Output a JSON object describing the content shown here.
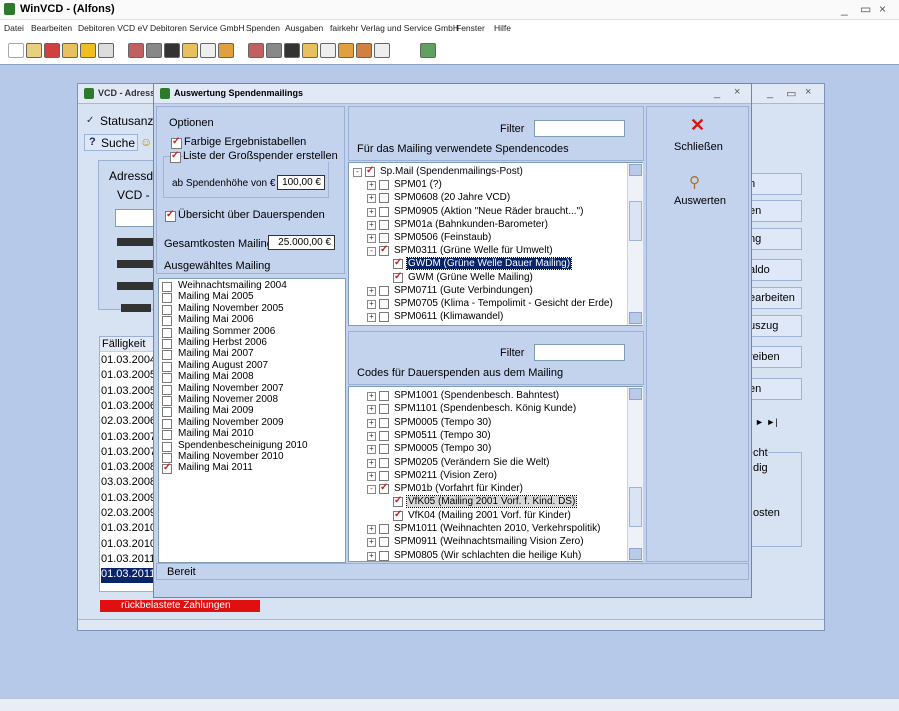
{
  "app": {
    "title": "WinVCD - (Alfons)"
  },
  "menu": [
    "Datei",
    "Bearbeiten",
    "Debitoren VCD eV",
    "Debitoren Service GmbH",
    "Spenden",
    "Ausgaben",
    "fairkehr Verlag und Service GmbH",
    "Fenster",
    "Hilfe"
  ],
  "toolbar": {
    "euro": "€"
  },
  "child": {
    "title": "VCD - Adressen",
    "statusanzeige": "Statusanzeige",
    "suche": "Suche",
    "adressda": "Adressda",
    "vcd_n": "VCD - N",
    "faelligkeit_header": "Fälligkeit",
    "dates": [
      "01.03.2004",
      "01.03.2005",
      "01.03.2005",
      "01.03.2006",
      "02.03.2006",
      "01.03.2007",
      "01.03.2007",
      "01.03.2008",
      "03.03.2008",
      "01.03.2009",
      "02.03.2009",
      "01.03.2010",
      "01.03.2010",
      "01.03.2011",
      "01.03.2011"
    ],
    "rueckbelastete": "rückbelastete Zahlungen",
    "right_buttons": [
      "n",
      "en",
      "ng",
      "aldo",
      "earbeiten",
      "uszug",
      "reiben",
      "en"
    ],
    "nav": "►    ►|",
    "right_texts": [
      "cht",
      "dig",
      "osten"
    ]
  },
  "dialog": {
    "title": "Auswertung Spendenmailings",
    "optionen": "Optionen",
    "farbige": "Farbige Ergebnistabellen",
    "liste": "Liste der Großspender erstellen",
    "ab_label": "ab Spendenhöhe von €",
    "ab_value": "100,00 €",
    "uebersicht": "Übersicht über Dauerspenden",
    "gesamt_label": "Gesamtkosten Mailing",
    "gesamt_value": "25.000,00 €",
    "ausgewaehlt": "Ausgewähltes Mailing",
    "mailings": [
      {
        "label": "Weihnachtsmailing 2004",
        "checked": false
      },
      {
        "label": "Mailing Mai 2005",
        "checked": false
      },
      {
        "label": "Mailing November 2005",
        "checked": false
      },
      {
        "label": "Mailing Mai 2006",
        "checked": false
      },
      {
        "label": "Mailing Sommer 2006",
        "checked": false
      },
      {
        "label": "Mailing Herbst 2006",
        "checked": false
      },
      {
        "label": "Mailing Mai 2007",
        "checked": false
      },
      {
        "label": "Mailing August 2007",
        "checked": false
      },
      {
        "label": "Mailing Mai 2008",
        "checked": false
      },
      {
        "label": "Mailing November 2007",
        "checked": false
      },
      {
        "label": "Mailing Novemer 2008",
        "checked": false
      },
      {
        "label": "Mailing Mai 2009",
        "checked": false
      },
      {
        "label": "Mailing November 2009",
        "checked": false
      },
      {
        "label": "Mailing Mai 2010",
        "checked": false
      },
      {
        "label": "Spendenbescheinigung 2010",
        "checked": false
      },
      {
        "label": "Mailing November 2010",
        "checked": false
      },
      {
        "label": "Mailing Mai 2011",
        "checked": true
      }
    ],
    "filter_label": "Filter",
    "codes_header": "Für das Mailing verwendete Spendencodes",
    "codes_tree": [
      {
        "label": "Sp.Mail (Spendenmailings-Post)",
        "level": 0,
        "exp": "-",
        "checked": true,
        "sel": false
      },
      {
        "label": "SPM01 (?)",
        "level": 1,
        "exp": "+",
        "checked": false,
        "sel": false
      },
      {
        "label": "SPM0608 (20 Jahre VCD)",
        "level": 1,
        "exp": "+",
        "checked": false,
        "sel": false
      },
      {
        "label": "SPM0905 (Aktion \"Neue Räder braucht...\")",
        "level": 1,
        "exp": "+",
        "checked": false,
        "sel": false
      },
      {
        "label": "SPM01a (Bahnkunden-Barometer)",
        "level": 1,
        "exp": "+",
        "checked": false,
        "sel": false
      },
      {
        "label": "SPM0506 (Feinstaub)",
        "level": 1,
        "exp": "+",
        "checked": false,
        "sel": false
      },
      {
        "label": "SPM0311 (Grüne Welle für Umwelt)",
        "level": 1,
        "exp": "-",
        "checked": true,
        "sel": false
      },
      {
        "label": "GWDM (Grüne Welle Dauer Mailing)",
        "level": 2,
        "exp": "",
        "checked": true,
        "sel": true
      },
      {
        "label": "GWM (Grüne Welle Mailing)",
        "level": 2,
        "exp": "",
        "checked": true,
        "sel": false
      },
      {
        "label": "SPM0711 (Gute Verbindungen)",
        "level": 1,
        "exp": "+",
        "checked": false,
        "sel": false
      },
      {
        "label": "SPM0705 (Klima - Tempolimit - Gesicht der Erde)",
        "level": 1,
        "exp": "+",
        "checked": false,
        "sel": false
      },
      {
        "label": "SPM0611 (Klimawandel)",
        "level": 1,
        "exp": "+",
        "checked": false,
        "sel": false
      }
    ],
    "dauer_header": "Codes für Dauerspenden aus dem Mailing",
    "dauer_tree": [
      {
        "label": "SPM1001 (Spendenbesch. Bahntest)",
        "level": 1,
        "exp": "+",
        "checked": false,
        "sel": false
      },
      {
        "label": "SPM1101 (Spendenbesch. König Kunde)",
        "level": 1,
        "exp": "+",
        "checked": false,
        "sel": false
      },
      {
        "label": "SPM0005 (Tempo 30)",
        "level": 1,
        "exp": "+",
        "checked": false,
        "sel": false
      },
      {
        "label": "SPM0511 (Tempo 30)",
        "level": 1,
        "exp": "+",
        "checked": false,
        "sel": false
      },
      {
        "label": "SPM0005 (Tempo 30)",
        "level": 1,
        "exp": "+",
        "checked": false,
        "sel": false
      },
      {
        "label": "SPM0205 (Verändern Sie die Welt)",
        "level": 1,
        "exp": "+",
        "checked": false,
        "sel": false
      },
      {
        "label": "SPM0211 (Vision Zero)",
        "level": 1,
        "exp": "+",
        "checked": false,
        "sel": false
      },
      {
        "label": "SPM01b (Vorfahrt für Kinder)",
        "level": 1,
        "exp": "-",
        "checked": true,
        "sel": false
      },
      {
        "label": "VfK05 (Mailing 2001 Vorf. f. Kind. DS)",
        "level": 2,
        "exp": "",
        "checked": true,
        "sel": true
      },
      {
        "label": "VfK04 (Mailing 2001 Vorf. für Kinder)",
        "level": 2,
        "exp": "",
        "checked": true,
        "sel": false
      },
      {
        "label": "SPM1011 (Weihnachten 2010, Verkehrspolitik)",
        "level": 1,
        "exp": "+",
        "checked": false,
        "sel": false
      },
      {
        "label": "SPM0911 (Weihnachtsmailing Vision Zero)",
        "level": 1,
        "exp": "+",
        "checked": false,
        "sel": false
      },
      {
        "label": "SPM0805 (Wir schlachten die heilige Kuh)",
        "level": 1,
        "exp": "+",
        "checked": false,
        "sel": false
      }
    ],
    "schliessen": "Schließen",
    "auswerten": "Auswerten",
    "status": "Bereit"
  },
  "colors": {
    "mdi": "#b7c9e8",
    "selection": "#0a246a",
    "red": "#e01010"
  }
}
